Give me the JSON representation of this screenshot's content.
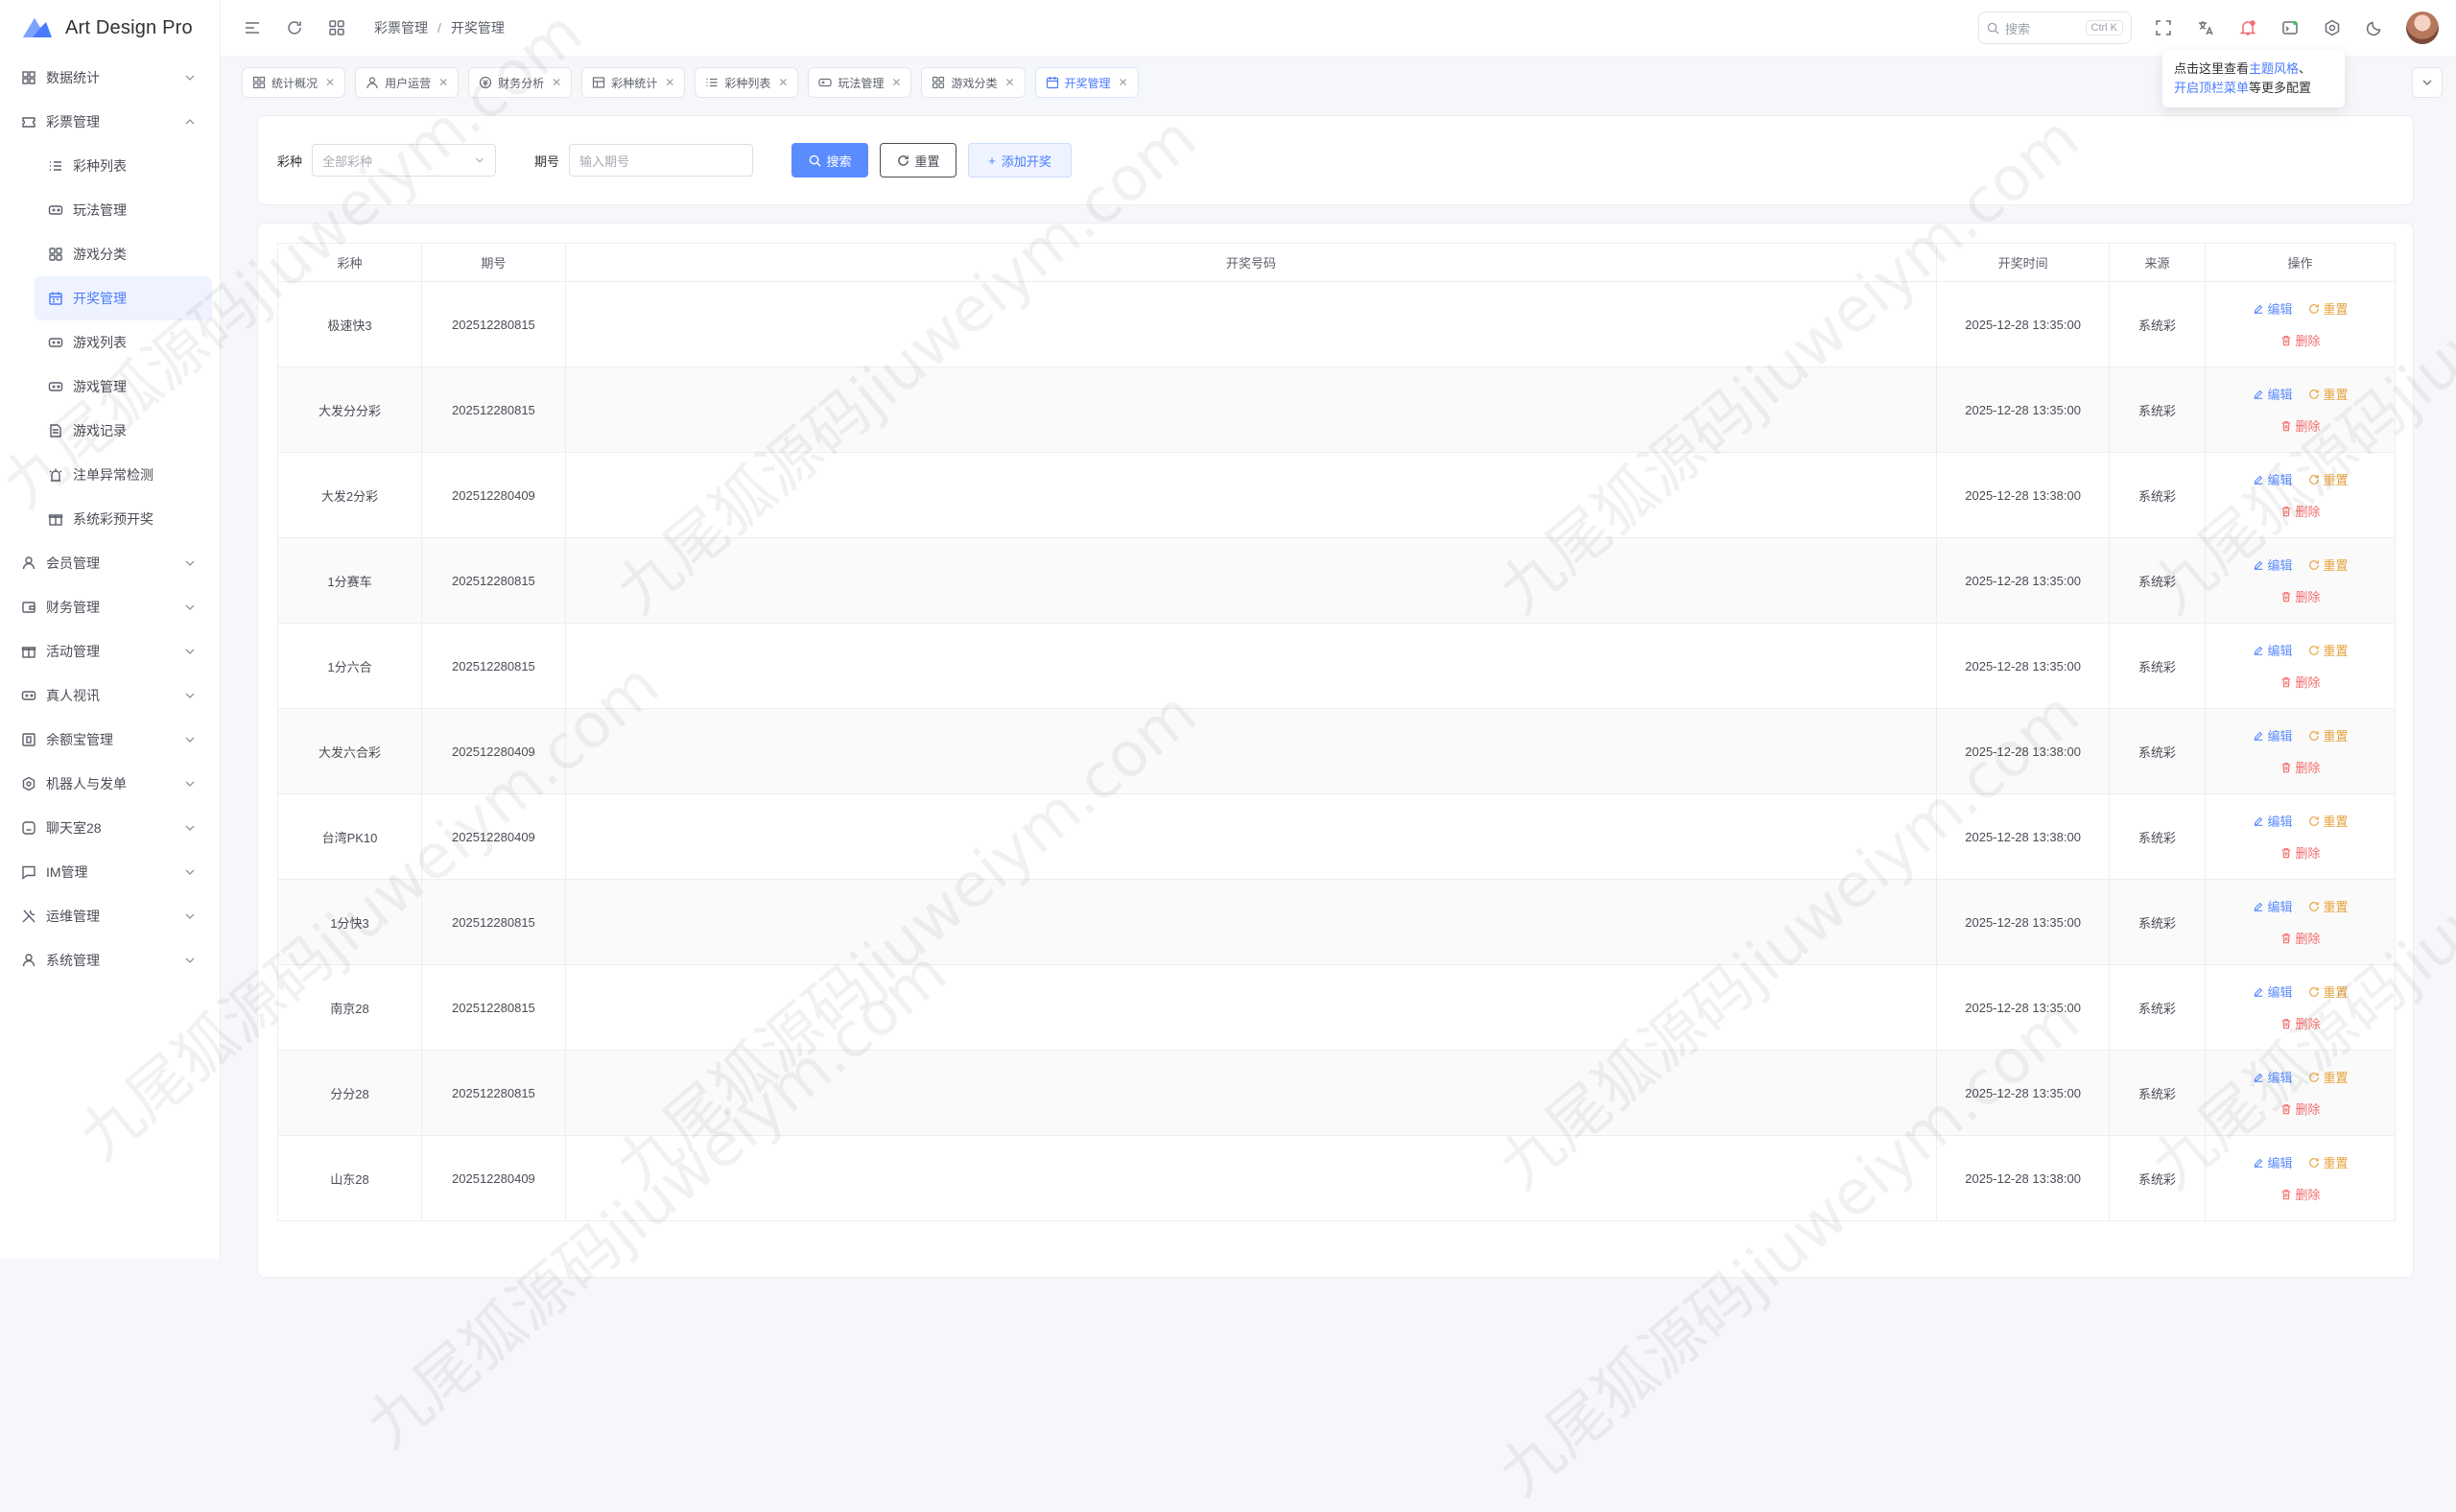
{
  "brand": {
    "name": "Art Design Pro"
  },
  "sidebar": {
    "items": [
      {
        "label": "数据统计",
        "icon": "dashboard-icon",
        "expanded": false
      },
      {
        "label": "彩票管理",
        "icon": "ticket-icon",
        "expanded": true
      },
      {
        "label": "会员管理",
        "icon": "user-icon",
        "expanded": false
      },
      {
        "label": "财务管理",
        "icon": "wallet-icon",
        "expanded": false
      },
      {
        "label": "活动管理",
        "icon": "gift-icon",
        "expanded": false
      },
      {
        "label": "真人视讯",
        "icon": "gamepad-icon",
        "expanded": false
      },
      {
        "label": "余额宝管理",
        "icon": "box-icon",
        "expanded": false
      },
      {
        "label": "机器人与发单",
        "icon": "robot-icon",
        "expanded": false
      },
      {
        "label": "聊天室28",
        "icon": "chat-box-icon",
        "expanded": false
      },
      {
        "label": "IM管理",
        "icon": "message-icon",
        "expanded": false
      },
      {
        "label": "运维管理",
        "icon": "tools-icon",
        "expanded": false
      },
      {
        "label": "系统管理",
        "icon": "user-icon",
        "expanded": false
      }
    ],
    "sub_items": [
      {
        "label": "彩种列表",
        "icon": "list-icon"
      },
      {
        "label": "玩法管理",
        "icon": "gamepad-icon"
      },
      {
        "label": "游戏分类",
        "icon": "grid-icon"
      },
      {
        "label": "开奖管理",
        "icon": "calendar-icon",
        "active": true
      },
      {
        "label": "游戏列表",
        "icon": "gamepad-icon"
      },
      {
        "label": "游戏管理",
        "icon": "gamepad-icon"
      },
      {
        "label": "游戏记录",
        "icon": "doc-icon"
      },
      {
        "label": "注单异常检测",
        "icon": "alarm-icon"
      },
      {
        "label": "系统彩预开奖",
        "icon": "gift-icon"
      }
    ]
  },
  "header": {
    "breadcrumb": [
      "彩票管理",
      "开奖管理"
    ],
    "search_placeholder": "搜索",
    "search_kbd": "Ctrl K"
  },
  "tabs": [
    {
      "label": "统计概况",
      "icon": "grid-icon"
    },
    {
      "label": "用户运营",
      "icon": "user-icon"
    },
    {
      "label": "财务分析",
      "icon": "money-icon"
    },
    {
      "label": "彩种统计",
      "icon": "table-icon"
    },
    {
      "label": "彩种列表",
      "icon": "list-icon"
    },
    {
      "label": "玩法管理",
      "icon": "gamepad-icon"
    },
    {
      "label": "游戏分类",
      "icon": "grid-icon"
    },
    {
      "label": "开奖管理",
      "icon": "calendar-icon",
      "active": true
    }
  ],
  "tooltip": {
    "line1_prefix": "点击这里查看",
    "line1_highlight": "主题风格",
    "line1_suffix": "、",
    "line2_highlight": "开启顶栏菜单",
    "line2_suffix": "等更多配置"
  },
  "filter": {
    "lottery_label": "彩种",
    "lottery_placeholder": "全部彩种",
    "issue_label": "期号",
    "issue_placeholder": "输入期号",
    "search_btn": "搜索",
    "reset_btn": "重置",
    "add_btn": "添加开奖"
  },
  "table": {
    "headers": [
      "彩种",
      "期号",
      "开奖号码",
      "开奖时间",
      "来源",
      "操作"
    ],
    "actions": {
      "edit": "编辑",
      "reset": "重置",
      "delete": "删除"
    },
    "rows": [
      {
        "lottery": "极速快3",
        "issue": "202512280815",
        "numbers": "",
        "time": "2025-12-28 13:35:00",
        "source": "系统彩"
      },
      {
        "lottery": "大发分分彩",
        "issue": "202512280815",
        "numbers": "",
        "time": "2025-12-28 13:35:00",
        "source": "系统彩"
      },
      {
        "lottery": "大发2分彩",
        "issue": "202512280409",
        "numbers": "",
        "time": "2025-12-28 13:38:00",
        "source": "系统彩"
      },
      {
        "lottery": "1分赛车",
        "issue": "202512280815",
        "numbers": "",
        "time": "2025-12-28 13:35:00",
        "source": "系统彩"
      },
      {
        "lottery": "1分六合",
        "issue": "202512280815",
        "numbers": "",
        "time": "2025-12-28 13:35:00",
        "source": "系统彩"
      },
      {
        "lottery": "大发六合彩",
        "issue": "202512280409",
        "numbers": "",
        "time": "2025-12-28 13:38:00",
        "source": "系统彩"
      },
      {
        "lottery": "台湾PK10",
        "issue": "202512280409",
        "numbers": "",
        "time": "2025-12-28 13:38:00",
        "source": "系统彩"
      },
      {
        "lottery": "1分快3",
        "issue": "202512280815",
        "numbers": "",
        "time": "2025-12-28 13:35:00",
        "source": "系统彩"
      },
      {
        "lottery": "南京28",
        "issue": "202512280815",
        "numbers": "",
        "time": "2025-12-28 13:35:00",
        "source": "系统彩"
      },
      {
        "lottery": "分分28",
        "issue": "202512280815",
        "numbers": "",
        "time": "2025-12-28 13:35:00",
        "source": "系统彩"
      },
      {
        "lottery": "山东28",
        "issue": "202512280409",
        "numbers": "",
        "time": "2025-12-28 13:38:00",
        "source": "系统彩"
      }
    ]
  },
  "watermark": {
    "text": "九尾狐源码jiuweiym.com"
  },
  "colors": {
    "accent": "#5b8cff",
    "reset": "#e6a23c",
    "danger": "#f56c6c"
  }
}
